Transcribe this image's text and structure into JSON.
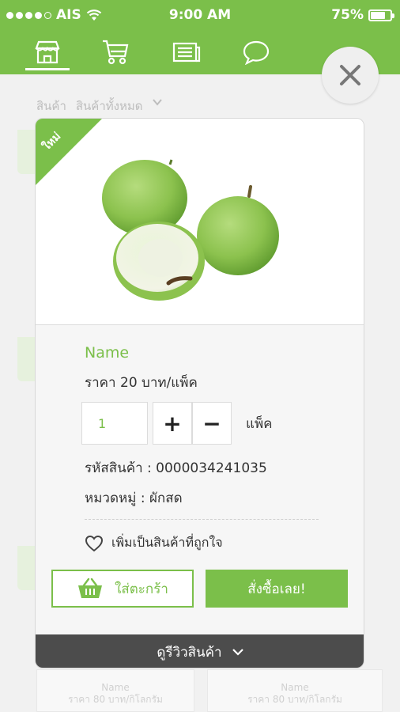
{
  "status_bar": {
    "carrier": "AIS",
    "time": "9:00 AM",
    "battery_percent": "75%",
    "battery_level": 0.75,
    "signal_bars": 5,
    "signal_filled": 4
  },
  "nav": {
    "tabs": [
      {
        "icon": "store-icon",
        "active": true
      },
      {
        "icon": "cart-icon",
        "active": false
      },
      {
        "icon": "news-icon",
        "active": false
      },
      {
        "icon": "chat-icon",
        "active": false
      }
    ]
  },
  "background_page": {
    "filter_label": "สินค้า",
    "filter_value": "สินค้าทั้งหมด",
    "card_captions": [
      {
        "name": "Name",
        "price": "ราคา 80 บาท/กิโลกรัม"
      },
      {
        "name": "Name",
        "price": "ราคา 80 บาท/กิโลกรัม"
      }
    ]
  },
  "product": {
    "badge": "ใหม่",
    "name": "Name",
    "price": "ราคา 20 บาท/แพ็ค",
    "quantity": "1",
    "unit": "แพ็ค",
    "sku": "รหัสสินค้า : 0000034241035",
    "category": "หมวดหมู่ : ผักสด",
    "favorite_label": "เพิ่มเป็นสินค้าที่ถูกใจ",
    "add_to_cart_label": "ใส่ตะกร้า",
    "buy_now_label": "สั่งซื้อเลย!",
    "review_label": "ดูรีวิวสินค้า",
    "plus_label": "+",
    "minus_label": "−"
  },
  "colors": {
    "brand_green": "#7bbf4a",
    "dark_bar": "#4c4c4c"
  }
}
